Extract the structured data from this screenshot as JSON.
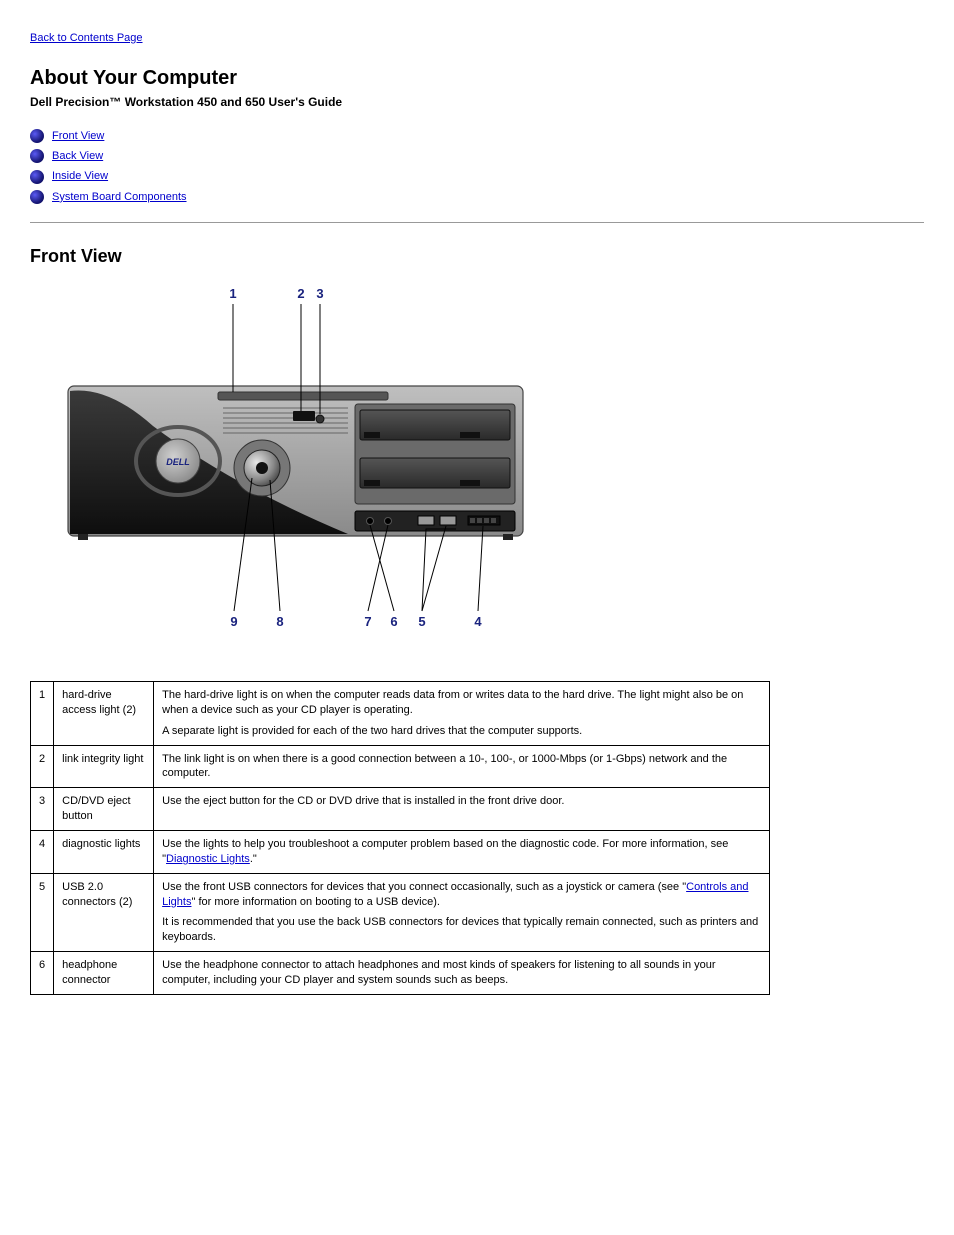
{
  "nav": {
    "back": "Back to Contents Page"
  },
  "title": "About Your Computer",
  "subtitle": "Dell Precision™ Workstation 450 and 650 User's Guide",
  "toc": [
    "Front View",
    "Back View",
    "Inside View",
    "System Board Components"
  ],
  "section_heading": "Front View",
  "callouts": {
    "c1": "1",
    "c2": "2",
    "c3": "3",
    "c4": "4",
    "c5": "5",
    "c6": "6",
    "c7": "7",
    "c8": "8",
    "c9": "9"
  },
  "logo": "DELL",
  "table": {
    "rows": [
      {
        "num": "1",
        "label": "hard-drive access light (2)",
        "desc_parts": [
          "The hard-drive light is on when the computer reads data from or writes data to the hard drive. The light might also be on when a device such as your CD player is operating.",
          "A separate light is provided for each of the two hard drives that the computer supports."
        ]
      },
      {
        "num": "2",
        "label": "link integrity light",
        "desc_parts": [
          "The link light is on when there is a good connection between a 10-, 100-, or 1000-Mbps (or 1-Gbps) network and the computer."
        ]
      },
      {
        "num": "3",
        "label": "CD/DVD eject button",
        "desc_parts": [
          "Use the eject button for the CD or DVD drive that is installed in the front drive door."
        ]
      },
      {
        "num": "4",
        "label": "diagnostic lights",
        "desc_parts": [
          "Use the lights to help you troubleshoot a computer problem based on the diagnostic code. For more information, see \"",
          "Diagnostic Lights",
          ".\""
        ]
      },
      {
        "num": "5",
        "label": "USB 2.0 connectors (2)",
        "desc_parts": [
          "Use the front USB connectors for devices that you connect occasionally, such as a joystick or camera (see \"",
          "Controls and Lights",
          "\" for more information on booting to a USB device).",
          "It is recommended that you use the back USB connectors for devices that typically remain connected, such as printers and keyboards."
        ]
      },
      {
        "num": "6",
        "label": "headphone connector",
        "desc_parts": [
          "Use the headphone connector to attach headphones and most kinds of speakers for listening to all sounds in your computer, including your CD player and system sounds such as beeps."
        ]
      }
    ]
  }
}
